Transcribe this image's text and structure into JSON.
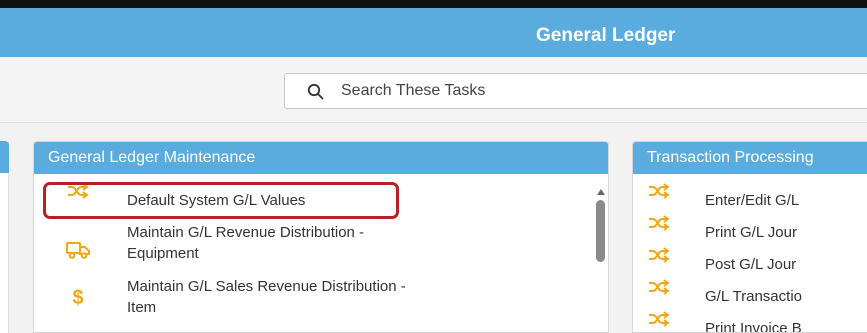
{
  "header": {
    "title": "General Ledger"
  },
  "search": {
    "placeholder": "Search These Tasks"
  },
  "maintenance_panel": {
    "title": "General Ledger Maintenance",
    "tasks": [
      {
        "icon": "shuffle-icon",
        "label": "Default System G/L Values"
      },
      {
        "icon": "truck-icon",
        "label_line1": "Maintain G/L Revenue Distribution -",
        "label_line2": "Equipment"
      },
      {
        "icon": "dollar-icon",
        "label_line1": "Maintain G/L Sales Revenue Distribution -",
        "label_line2": "Item"
      }
    ]
  },
  "transaction_panel": {
    "title": "Transaction Processing",
    "tasks": [
      {
        "icon": "shuffle-icon",
        "label": "Enter/Edit G/L"
      },
      {
        "icon": "shuffle-icon",
        "label": "Print G/L Jour"
      },
      {
        "icon": "shuffle-icon",
        "label": "Post G/L Jour"
      },
      {
        "icon": "shuffle-icon",
        "label": "G/L Transactio"
      },
      {
        "icon": "shuffle-icon",
        "label": "Print Invoice B"
      }
    ]
  },
  "colors": {
    "header_blue": "#5aacdf",
    "icon_orange": "#f0a818",
    "highlight_red": "#b72025"
  }
}
